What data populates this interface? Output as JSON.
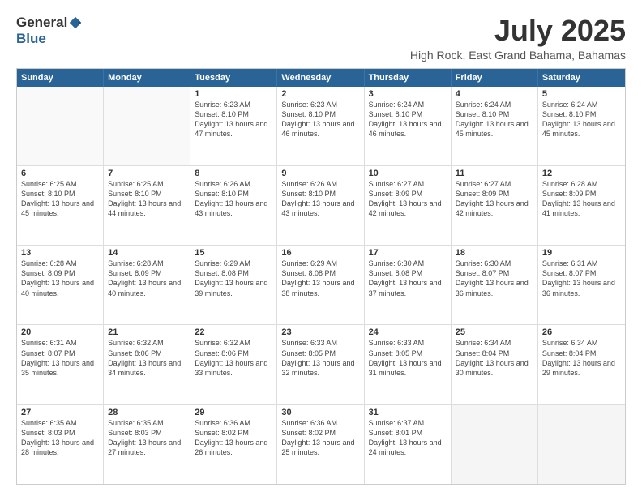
{
  "logo": {
    "general": "General",
    "blue": "Blue"
  },
  "title": "July 2025",
  "location": "High Rock, East Grand Bahama, Bahamas",
  "header_days": [
    "Sunday",
    "Monday",
    "Tuesday",
    "Wednesday",
    "Thursday",
    "Friday",
    "Saturday"
  ],
  "weeks": [
    [
      {
        "day": "",
        "info": ""
      },
      {
        "day": "",
        "info": ""
      },
      {
        "day": "1",
        "info": "Sunrise: 6:23 AM\nSunset: 8:10 PM\nDaylight: 13 hours and 47 minutes."
      },
      {
        "day": "2",
        "info": "Sunrise: 6:23 AM\nSunset: 8:10 PM\nDaylight: 13 hours and 46 minutes."
      },
      {
        "day": "3",
        "info": "Sunrise: 6:24 AM\nSunset: 8:10 PM\nDaylight: 13 hours and 46 minutes."
      },
      {
        "day": "4",
        "info": "Sunrise: 6:24 AM\nSunset: 8:10 PM\nDaylight: 13 hours and 45 minutes."
      },
      {
        "day": "5",
        "info": "Sunrise: 6:24 AM\nSunset: 8:10 PM\nDaylight: 13 hours and 45 minutes."
      }
    ],
    [
      {
        "day": "6",
        "info": "Sunrise: 6:25 AM\nSunset: 8:10 PM\nDaylight: 13 hours and 45 minutes."
      },
      {
        "day": "7",
        "info": "Sunrise: 6:25 AM\nSunset: 8:10 PM\nDaylight: 13 hours and 44 minutes."
      },
      {
        "day": "8",
        "info": "Sunrise: 6:26 AM\nSunset: 8:10 PM\nDaylight: 13 hours and 43 minutes."
      },
      {
        "day": "9",
        "info": "Sunrise: 6:26 AM\nSunset: 8:10 PM\nDaylight: 13 hours and 43 minutes."
      },
      {
        "day": "10",
        "info": "Sunrise: 6:27 AM\nSunset: 8:09 PM\nDaylight: 13 hours and 42 minutes."
      },
      {
        "day": "11",
        "info": "Sunrise: 6:27 AM\nSunset: 8:09 PM\nDaylight: 13 hours and 42 minutes."
      },
      {
        "day": "12",
        "info": "Sunrise: 6:28 AM\nSunset: 8:09 PM\nDaylight: 13 hours and 41 minutes."
      }
    ],
    [
      {
        "day": "13",
        "info": "Sunrise: 6:28 AM\nSunset: 8:09 PM\nDaylight: 13 hours and 40 minutes."
      },
      {
        "day": "14",
        "info": "Sunrise: 6:28 AM\nSunset: 8:09 PM\nDaylight: 13 hours and 40 minutes."
      },
      {
        "day": "15",
        "info": "Sunrise: 6:29 AM\nSunset: 8:08 PM\nDaylight: 13 hours and 39 minutes."
      },
      {
        "day": "16",
        "info": "Sunrise: 6:29 AM\nSunset: 8:08 PM\nDaylight: 13 hours and 38 minutes."
      },
      {
        "day": "17",
        "info": "Sunrise: 6:30 AM\nSunset: 8:08 PM\nDaylight: 13 hours and 37 minutes."
      },
      {
        "day": "18",
        "info": "Sunrise: 6:30 AM\nSunset: 8:07 PM\nDaylight: 13 hours and 36 minutes."
      },
      {
        "day": "19",
        "info": "Sunrise: 6:31 AM\nSunset: 8:07 PM\nDaylight: 13 hours and 36 minutes."
      }
    ],
    [
      {
        "day": "20",
        "info": "Sunrise: 6:31 AM\nSunset: 8:07 PM\nDaylight: 13 hours and 35 minutes."
      },
      {
        "day": "21",
        "info": "Sunrise: 6:32 AM\nSunset: 8:06 PM\nDaylight: 13 hours and 34 minutes."
      },
      {
        "day": "22",
        "info": "Sunrise: 6:32 AM\nSunset: 8:06 PM\nDaylight: 13 hours and 33 minutes."
      },
      {
        "day": "23",
        "info": "Sunrise: 6:33 AM\nSunset: 8:05 PM\nDaylight: 13 hours and 32 minutes."
      },
      {
        "day": "24",
        "info": "Sunrise: 6:33 AM\nSunset: 8:05 PM\nDaylight: 13 hours and 31 minutes."
      },
      {
        "day": "25",
        "info": "Sunrise: 6:34 AM\nSunset: 8:04 PM\nDaylight: 13 hours and 30 minutes."
      },
      {
        "day": "26",
        "info": "Sunrise: 6:34 AM\nSunset: 8:04 PM\nDaylight: 13 hours and 29 minutes."
      }
    ],
    [
      {
        "day": "27",
        "info": "Sunrise: 6:35 AM\nSunset: 8:03 PM\nDaylight: 13 hours and 28 minutes."
      },
      {
        "day": "28",
        "info": "Sunrise: 6:35 AM\nSunset: 8:03 PM\nDaylight: 13 hours and 27 minutes."
      },
      {
        "day": "29",
        "info": "Sunrise: 6:36 AM\nSunset: 8:02 PM\nDaylight: 13 hours and 26 minutes."
      },
      {
        "day": "30",
        "info": "Sunrise: 6:36 AM\nSunset: 8:02 PM\nDaylight: 13 hours and 25 minutes."
      },
      {
        "day": "31",
        "info": "Sunrise: 6:37 AM\nSunset: 8:01 PM\nDaylight: 13 hours and 24 minutes."
      },
      {
        "day": "",
        "info": ""
      },
      {
        "day": "",
        "info": ""
      }
    ]
  ]
}
